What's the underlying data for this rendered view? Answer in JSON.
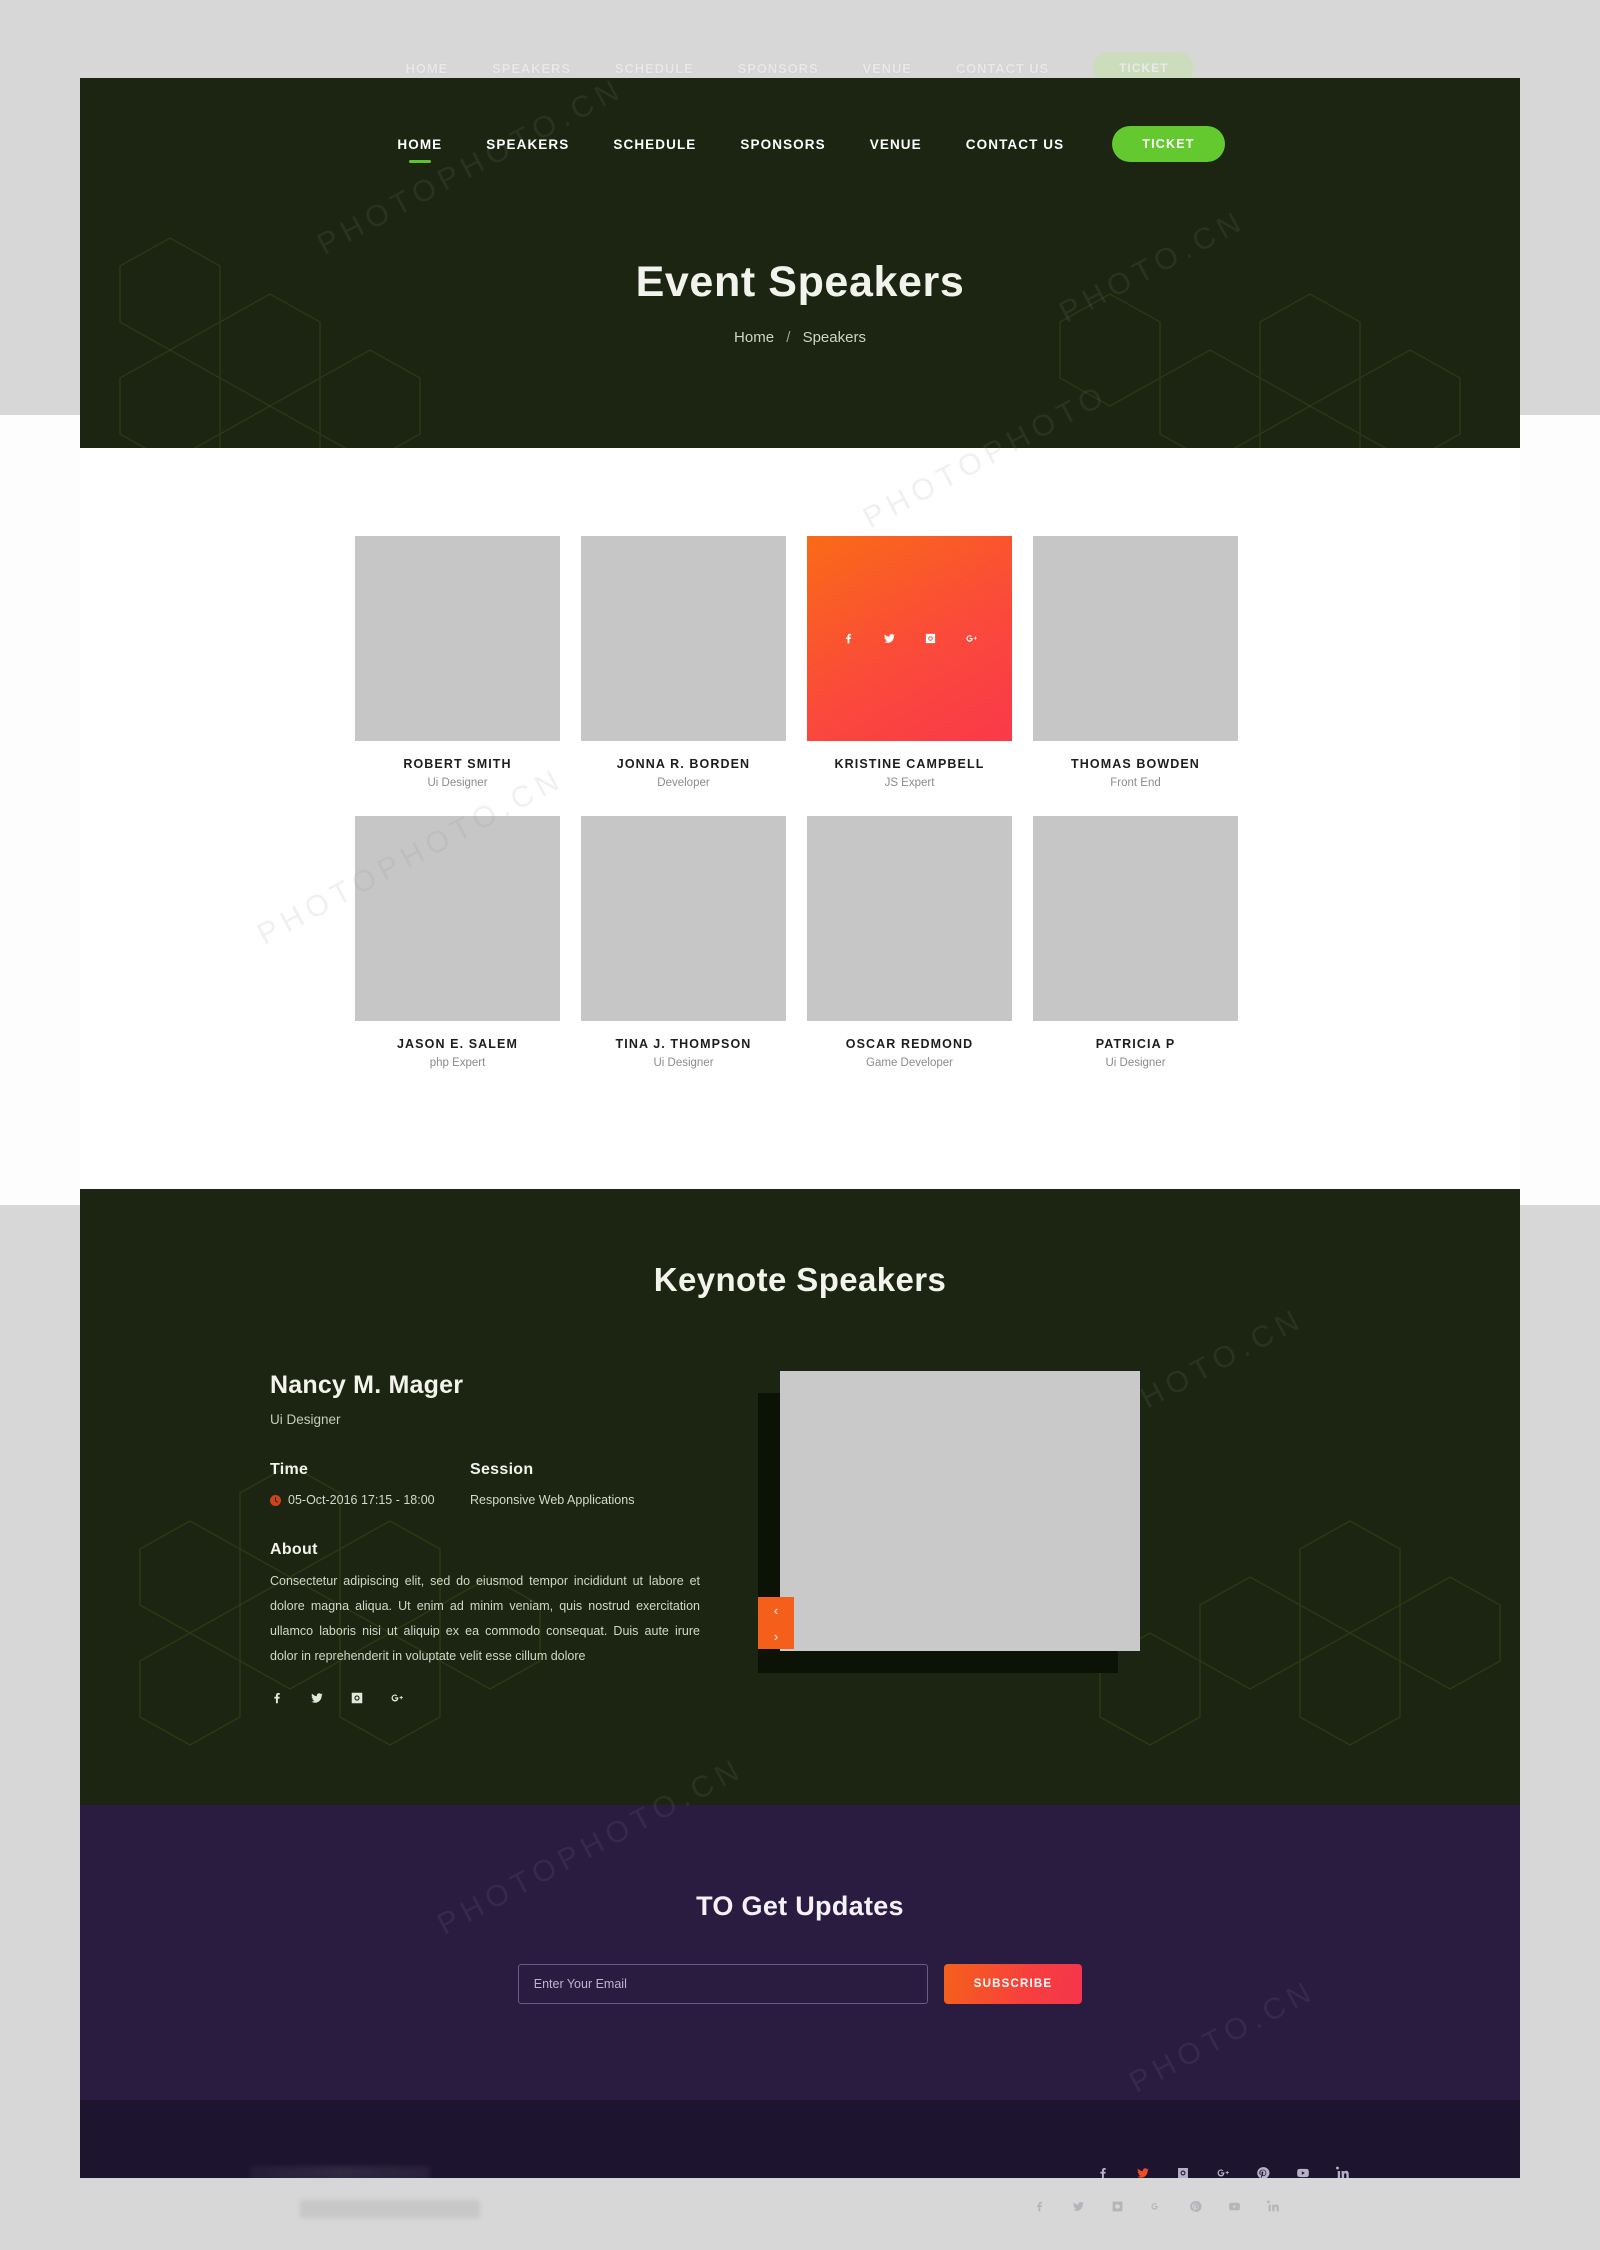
{
  "nav": {
    "items": [
      {
        "label": "HOME",
        "active": true
      },
      {
        "label": "SPEAKERS",
        "active": false
      },
      {
        "label": "SCHEDULE",
        "active": false
      },
      {
        "label": "SPONSORS",
        "active": false
      },
      {
        "label": "VENUE",
        "active": false
      },
      {
        "label": "CONTACT US",
        "active": false
      }
    ],
    "ticket_label": "TICKET",
    "ticket_color": "#63c92f"
  },
  "hero": {
    "title": "Event Speakers",
    "breadcrumb_home": "Home",
    "breadcrumb_sep": "/",
    "breadcrumb_current": "Speakers",
    "bg_color": "#1c2512"
  },
  "speakers": {
    "items": [
      {
        "name": "ROBERT SMITH",
        "role": "Ui Designer",
        "active": false
      },
      {
        "name": "JONNA R. BORDEN",
        "role": "Developer",
        "active": false
      },
      {
        "name": "KRISTINE CAMPBELL",
        "role": "JS Expert",
        "active": true
      },
      {
        "name": "THOMAS BOWDEN",
        "role": "Front End",
        "active": false
      },
      {
        "name": "JASON E. SALEM",
        "role": "php Expert",
        "active": false
      },
      {
        "name": "TINA J. THOMPSON",
        "role": "Ui Designer",
        "active": false
      },
      {
        "name": "OSCAR REDMOND",
        "role": "Game Developer",
        "active": false
      },
      {
        "name": "PATRICIA P",
        "role": "Ui Designer",
        "active": false
      }
    ],
    "card_socials": [
      "facebook-icon",
      "twitter-icon",
      "instagram-icon",
      "google-plus-icon"
    ],
    "active_card_color": "#fb4a3a"
  },
  "keynote": {
    "title": "Keynote Speakers",
    "name": "Nancy M. Mager",
    "role": "Ui Designer",
    "time_label": "Time",
    "time_value": "05-Oct-2016 17:15 - 18:00",
    "session_label": "Session",
    "session_value": "Responsive Web Applications",
    "about_label": "About",
    "about_text": "Consectetur adipiscing elit, sed do eiusmod tempor incididunt ut labore et dolore magna aliqua. Ut enim ad minim veniam, quis nostrud exercitation ullamco laboris nisi ut aliquip ex ea commodo consequat. Duis aute irure dolor in reprehenderit in voluptate velit esse cillum dolore",
    "socials": [
      "facebook-icon",
      "twitter-icon",
      "instagram-icon",
      "google-plus-icon"
    ],
    "prev_arrow": "‹",
    "next_arrow": "›",
    "arrow_color": "#f4601c"
  },
  "subscribe": {
    "title": "TO Get Updates",
    "email_placeholder": "Enter Your Email",
    "email_value": "",
    "button_label": "SUBSCRIBE",
    "bg_color": "#2a1b41"
  },
  "footer": {
    "socials": [
      {
        "name": "facebook-icon",
        "hot": false
      },
      {
        "name": "twitter-icon",
        "hot": true
      },
      {
        "name": "instagram-icon",
        "hot": false
      },
      {
        "name": "google-plus-icon",
        "hot": false
      },
      {
        "name": "pinterest-icon",
        "hot": false
      },
      {
        "name": "youtube-icon",
        "hot": false
      },
      {
        "name": "linkedin-icon",
        "hot": false
      }
    ],
    "bg_color": "#1d1430"
  }
}
